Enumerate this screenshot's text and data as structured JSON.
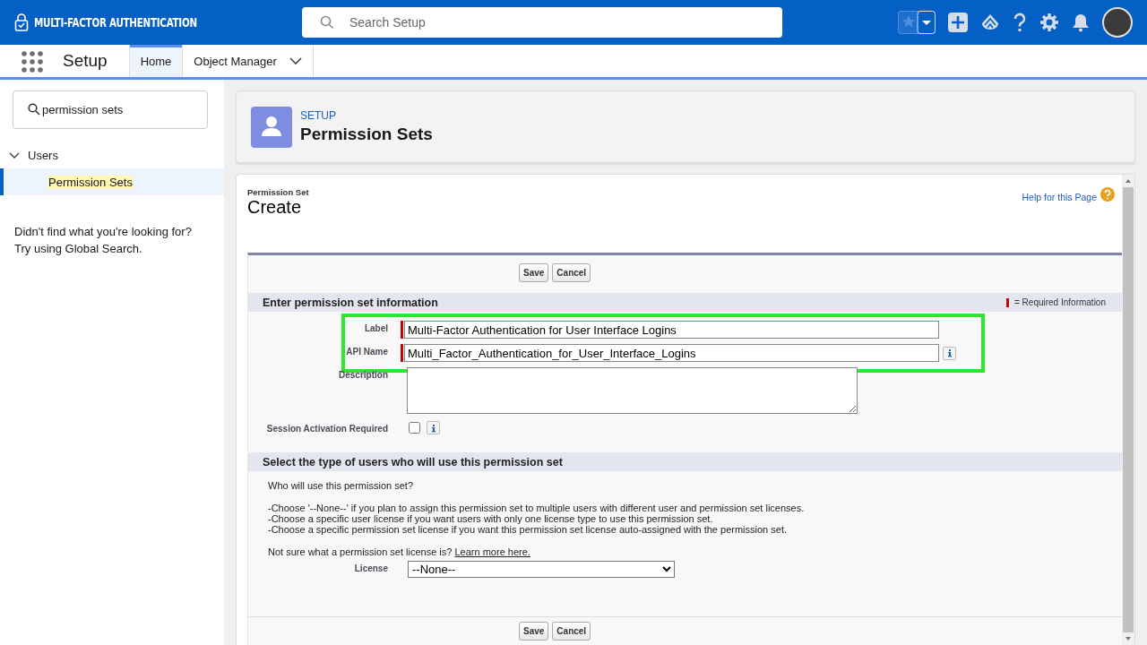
{
  "app": {
    "name": "MULTI-FACTOR AUTHENTICATION",
    "search_placeholder": "Search Setup"
  },
  "nav": {
    "title": "Setup",
    "tabs": [
      {
        "label": "Home",
        "selected": true,
        "dropdown": false
      },
      {
        "label": "Object Manager",
        "selected": false,
        "dropdown": true
      }
    ]
  },
  "sidebar": {
    "search_value": "permission sets",
    "tree": [
      {
        "label": "Users",
        "expanded": true,
        "children": [
          {
            "label": "Permission Sets",
            "selected": true
          }
        ]
      }
    ],
    "hint": [
      "Didn't find what you're looking for?",
      "Try using Global Search."
    ]
  },
  "page_header": {
    "eyebrow": "SETUP",
    "title": "Permission Sets"
  },
  "form": {
    "eyebrow": "Permission Set",
    "title": "Create",
    "help_link": "Help for this Page",
    "buttons": [
      "Save",
      "Cancel"
    ],
    "section_1": {
      "title": "Enter permission set information",
      "required_legend": "= Required Information",
      "fields": [
        {
          "kind": "text",
          "label": "Label",
          "value": "Multi-Factor Authentication for User Interface Logins",
          "required": true,
          "highlighted": true,
          "info": false
        },
        {
          "kind": "text",
          "label": "API Name",
          "value": "Multi_Factor_Authentication_for_User_Interface_Logins",
          "required": true,
          "highlighted": true,
          "info": true
        },
        {
          "kind": "textarea",
          "label": "Description",
          "required": false,
          "highlighted": false,
          "info": false
        },
        {
          "kind": "checkbox",
          "label": "Session Activation Required",
          "checked": false,
          "required": false,
          "highlighted": false,
          "info": true
        }
      ]
    },
    "section_2": {
      "title": "Select the type of users who will use this permission set",
      "question": "Who will use this permission set?",
      "instructions": [
        "-Choose '--None--' if you plan to assign this permission set to multiple users with different user and permission set licenses.",
        "-Choose a specific user license if you want users with only one license type to use this permission set.",
        "-Choose a specific permission set license if you want this permission set license auto-assigned with the permission set."
      ],
      "learn_prompt": "Not sure what a permission set license is?",
      "learn_link": "Learn more here.",
      "license": {
        "label": "License",
        "value": "--None--"
      }
    },
    "bottom_buttons": [
      "Save",
      "Cancel"
    ]
  }
}
